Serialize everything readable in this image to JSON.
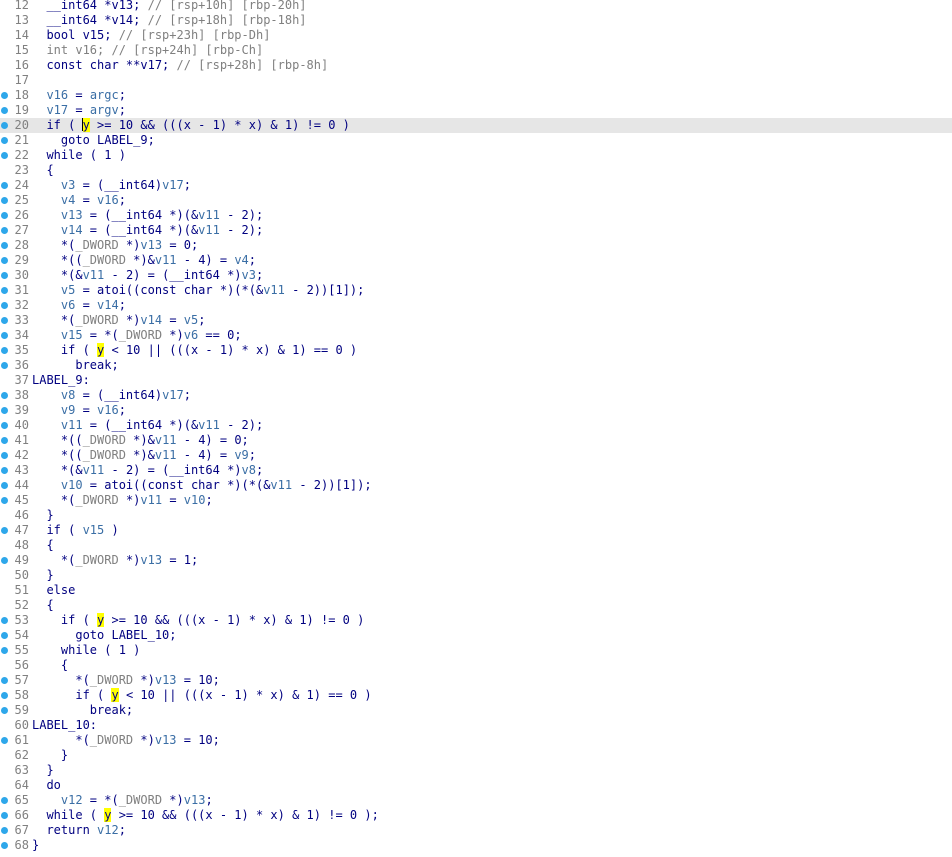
{
  "editor": {
    "current_line": 20,
    "caret": {
      "line": 20,
      "token": 1
    },
    "lines": [
      {
        "n": "12",
        "bp": false,
        "t": [
          [
            "k",
            "  __int64 *v13; "
          ],
          [
            "c",
            "// [rsp+10h] [rbp-20h]"
          ]
        ]
      },
      {
        "n": "13",
        "bp": false,
        "t": [
          [
            "k",
            "  __int64 *v14; "
          ],
          [
            "c",
            "// [rsp+18h] [rbp-18h]"
          ]
        ]
      },
      {
        "n": "14",
        "bp": false,
        "t": [
          [
            "k",
            "  bool v15; "
          ],
          [
            "c",
            "// [rsp+23h] [rbp-Dh]"
          ]
        ]
      },
      {
        "n": "15",
        "bp": false,
        "t": [
          [
            "g",
            "  int v16; "
          ],
          [
            "c",
            "// [rsp+24h] [rbp-Ch]"
          ]
        ]
      },
      {
        "n": "16",
        "bp": false,
        "t": [
          [
            "k",
            "  const char **v17; "
          ],
          [
            "c",
            "// [rsp+28h] [rbp-8h]"
          ]
        ]
      },
      {
        "n": "17",
        "bp": false,
        "t": []
      },
      {
        "n": "18",
        "bp": true,
        "t": [
          [
            "v",
            "  v16"
          ],
          [
            "k",
            " = "
          ],
          [
            "v",
            "argc"
          ],
          [
            "k",
            ";"
          ]
        ]
      },
      {
        "n": "19",
        "bp": true,
        "t": [
          [
            "v",
            "  v17"
          ],
          [
            "k",
            " = "
          ],
          [
            "v",
            "argv"
          ],
          [
            "k",
            ";"
          ]
        ]
      },
      {
        "n": "20",
        "bp": true,
        "t": [
          [
            "k",
            "  if ( "
          ],
          [
            "h",
            "y"
          ],
          [
            "k",
            " >= 10 && (((x - 1) * x) & 1) != 0 )"
          ]
        ]
      },
      {
        "n": "21",
        "bp": true,
        "t": [
          [
            "k",
            "    goto LABEL_9;"
          ]
        ]
      },
      {
        "n": "22",
        "bp": true,
        "t": [
          [
            "k",
            "  while ( 1 )"
          ]
        ]
      },
      {
        "n": "23",
        "bp": false,
        "t": [
          [
            "k",
            "  {"
          ]
        ]
      },
      {
        "n": "24",
        "bp": true,
        "t": [
          [
            "v",
            "    v3"
          ],
          [
            "k",
            " = (__int64)"
          ],
          [
            "v",
            "v17"
          ],
          [
            "k",
            ";"
          ]
        ]
      },
      {
        "n": "25",
        "bp": true,
        "t": [
          [
            "v",
            "    v4"
          ],
          [
            "k",
            " = "
          ],
          [
            "v",
            "v16"
          ],
          [
            "k",
            ";"
          ]
        ]
      },
      {
        "n": "26",
        "bp": true,
        "t": [
          [
            "v",
            "    v13"
          ],
          [
            "k",
            " = (__int64 *)(&"
          ],
          [
            "v",
            "v11"
          ],
          [
            "k",
            " - 2);"
          ]
        ]
      },
      {
        "n": "27",
        "bp": true,
        "t": [
          [
            "v",
            "    v14"
          ],
          [
            "k",
            " = (__int64 *)(&"
          ],
          [
            "v",
            "v11"
          ],
          [
            "k",
            " - 2);"
          ]
        ]
      },
      {
        "n": "28",
        "bp": true,
        "t": [
          [
            "k",
            "    *("
          ],
          [
            "g",
            "_DWORD"
          ],
          [
            "k",
            " *)"
          ],
          [
            "v",
            "v13"
          ],
          [
            "k",
            " = 0;"
          ]
        ]
      },
      {
        "n": "29",
        "bp": true,
        "t": [
          [
            "k",
            "    *(("
          ],
          [
            "g",
            "_DWORD"
          ],
          [
            "k",
            " *)&"
          ],
          [
            "v",
            "v11"
          ],
          [
            "k",
            " - 4) = "
          ],
          [
            "v",
            "v4"
          ],
          [
            "k",
            ";"
          ]
        ]
      },
      {
        "n": "30",
        "bp": true,
        "t": [
          [
            "k",
            "    *(&"
          ],
          [
            "v",
            "v11"
          ],
          [
            "k",
            " - 2) = (__int64 *)"
          ],
          [
            "v",
            "v3"
          ],
          [
            "k",
            ";"
          ]
        ]
      },
      {
        "n": "31",
        "bp": true,
        "t": [
          [
            "v",
            "    v5"
          ],
          [
            "k",
            " = atoi((const char *)(*(&"
          ],
          [
            "v",
            "v11"
          ],
          [
            "k",
            " - 2))[1]);"
          ]
        ]
      },
      {
        "n": "32",
        "bp": true,
        "t": [
          [
            "v",
            "    v6"
          ],
          [
            "k",
            " = "
          ],
          [
            "v",
            "v14"
          ],
          [
            "k",
            ";"
          ]
        ]
      },
      {
        "n": "33",
        "bp": true,
        "t": [
          [
            "k",
            "    *("
          ],
          [
            "g",
            "_DWORD"
          ],
          [
            "k",
            " *)"
          ],
          [
            "v",
            "v14"
          ],
          [
            "k",
            " = "
          ],
          [
            "v",
            "v5"
          ],
          [
            "k",
            ";"
          ]
        ]
      },
      {
        "n": "34",
        "bp": true,
        "t": [
          [
            "v",
            "    v15"
          ],
          [
            "k",
            " = *("
          ],
          [
            "g",
            "_DWORD"
          ],
          [
            "k",
            " *)"
          ],
          [
            "v",
            "v6"
          ],
          [
            "k",
            " == 0;"
          ]
        ]
      },
      {
        "n": "35",
        "bp": true,
        "t": [
          [
            "k",
            "    if ( "
          ],
          [
            "h",
            "y"
          ],
          [
            "k",
            " < 10 || (((x - 1) * x) & 1) == 0 )"
          ]
        ]
      },
      {
        "n": "36",
        "bp": true,
        "t": [
          [
            "k",
            "      break;"
          ]
        ]
      },
      {
        "n": "37",
        "bp": false,
        "t": [
          [
            "k",
            "LABEL_9:"
          ]
        ],
        "label": true
      },
      {
        "n": "38",
        "bp": true,
        "t": [
          [
            "v",
            "    v8"
          ],
          [
            "k",
            " = (__int64)"
          ],
          [
            "v",
            "v17"
          ],
          [
            "k",
            ";"
          ]
        ]
      },
      {
        "n": "39",
        "bp": true,
        "t": [
          [
            "v",
            "    v9"
          ],
          [
            "k",
            " = "
          ],
          [
            "v",
            "v16"
          ],
          [
            "k",
            ";"
          ]
        ]
      },
      {
        "n": "40",
        "bp": true,
        "t": [
          [
            "v",
            "    v11"
          ],
          [
            "k",
            " = (__int64 *)(&"
          ],
          [
            "v",
            "v11"
          ],
          [
            "k",
            " - 2);"
          ]
        ]
      },
      {
        "n": "41",
        "bp": true,
        "t": [
          [
            "k",
            "    *(("
          ],
          [
            "g",
            "_DWORD"
          ],
          [
            "k",
            " *)&"
          ],
          [
            "v",
            "v11"
          ],
          [
            "k",
            " - 4) = 0;"
          ]
        ]
      },
      {
        "n": "42",
        "bp": true,
        "t": [
          [
            "k",
            "    *(("
          ],
          [
            "g",
            "_DWORD"
          ],
          [
            "k",
            " *)&"
          ],
          [
            "v",
            "v11"
          ],
          [
            "k",
            " - 4) = "
          ],
          [
            "v",
            "v9"
          ],
          [
            "k",
            ";"
          ]
        ]
      },
      {
        "n": "43",
        "bp": true,
        "t": [
          [
            "k",
            "    *(&"
          ],
          [
            "v",
            "v11"
          ],
          [
            "k",
            " - 2) = (__int64 *)"
          ],
          [
            "v",
            "v8"
          ],
          [
            "k",
            ";"
          ]
        ]
      },
      {
        "n": "44",
        "bp": true,
        "t": [
          [
            "v",
            "    v10"
          ],
          [
            "k",
            " = atoi((const char *)(*(&"
          ],
          [
            "v",
            "v11"
          ],
          [
            "k",
            " - 2))[1]);"
          ]
        ]
      },
      {
        "n": "45",
        "bp": true,
        "t": [
          [
            "k",
            "    *("
          ],
          [
            "g",
            "_DWORD"
          ],
          [
            "k",
            " *)"
          ],
          [
            "v",
            "v11"
          ],
          [
            "k",
            " = "
          ],
          [
            "v",
            "v10"
          ],
          [
            "k",
            ";"
          ]
        ]
      },
      {
        "n": "46",
        "bp": false,
        "t": [
          [
            "k",
            "  }"
          ]
        ]
      },
      {
        "n": "47",
        "bp": true,
        "t": [
          [
            "k",
            "  if ( "
          ],
          [
            "v",
            "v15"
          ],
          [
            "k",
            " )"
          ]
        ]
      },
      {
        "n": "48",
        "bp": false,
        "t": [
          [
            "k",
            "  {"
          ]
        ]
      },
      {
        "n": "49",
        "bp": true,
        "t": [
          [
            "k",
            "    *("
          ],
          [
            "g",
            "_DWORD"
          ],
          [
            "k",
            " *)"
          ],
          [
            "v",
            "v13"
          ],
          [
            "k",
            " = 1;"
          ]
        ]
      },
      {
        "n": "50",
        "bp": false,
        "t": [
          [
            "k",
            "  }"
          ]
        ]
      },
      {
        "n": "51",
        "bp": false,
        "t": [
          [
            "k",
            "  else"
          ]
        ]
      },
      {
        "n": "52",
        "bp": false,
        "t": [
          [
            "k",
            "  {"
          ]
        ]
      },
      {
        "n": "53",
        "bp": true,
        "t": [
          [
            "k",
            "    if ( "
          ],
          [
            "h",
            "y"
          ],
          [
            "k",
            " >= 10 && (((x - 1) * x) & 1) != 0 )"
          ]
        ]
      },
      {
        "n": "54",
        "bp": true,
        "t": [
          [
            "k",
            "      goto LABEL_10;"
          ]
        ]
      },
      {
        "n": "55",
        "bp": true,
        "t": [
          [
            "k",
            "    while ( 1 )"
          ]
        ]
      },
      {
        "n": "56",
        "bp": false,
        "t": [
          [
            "k",
            "    {"
          ]
        ]
      },
      {
        "n": "57",
        "bp": true,
        "t": [
          [
            "k",
            "      *("
          ],
          [
            "g",
            "_DWORD"
          ],
          [
            "k",
            " *)"
          ],
          [
            "v",
            "v13"
          ],
          [
            "k",
            " = 10;"
          ]
        ]
      },
      {
        "n": "58",
        "bp": true,
        "t": [
          [
            "k",
            "      if ( "
          ],
          [
            "h",
            "y"
          ],
          [
            "k",
            " < 10 || (((x - 1) * x) & 1) == 0 )"
          ]
        ]
      },
      {
        "n": "59",
        "bp": true,
        "t": [
          [
            "k",
            "        break;"
          ]
        ]
      },
      {
        "n": "60",
        "bp": false,
        "t": [
          [
            "k",
            "LABEL_10:"
          ]
        ],
        "label": true
      },
      {
        "n": "61",
        "bp": true,
        "t": [
          [
            "k",
            "      *("
          ],
          [
            "g",
            "_DWORD"
          ],
          [
            "k",
            " *)"
          ],
          [
            "v",
            "v13"
          ],
          [
            "k",
            " = 10;"
          ]
        ]
      },
      {
        "n": "62",
        "bp": false,
        "t": [
          [
            "k",
            "    }"
          ]
        ]
      },
      {
        "n": "63",
        "bp": false,
        "t": [
          [
            "k",
            "  }"
          ]
        ]
      },
      {
        "n": "64",
        "bp": false,
        "t": [
          [
            "k",
            "  do"
          ]
        ]
      },
      {
        "n": "65",
        "bp": true,
        "t": [
          [
            "v",
            "    v12"
          ],
          [
            "k",
            " = *("
          ],
          [
            "g",
            "_DWORD"
          ],
          [
            "k",
            " *)"
          ],
          [
            "v",
            "v13"
          ],
          [
            "k",
            ";"
          ]
        ]
      },
      {
        "n": "66",
        "bp": true,
        "t": [
          [
            "k",
            "  while ( "
          ],
          [
            "h",
            "y"
          ],
          [
            "k",
            " >= 10 && (((x - 1) * x) & 1) != 0 );"
          ]
        ]
      },
      {
        "n": "67",
        "bp": true,
        "t": [
          [
            "k",
            "  return "
          ],
          [
            "v",
            "v12"
          ],
          [
            "k",
            ";"
          ]
        ]
      },
      {
        "n": "68",
        "bp": true,
        "t": [
          [
            "k",
            "}"
          ]
        ],
        "label": true
      }
    ]
  },
  "colors": {
    "keyword_text": "#000080",
    "variable": "#3a6ea5",
    "comment": "#808080",
    "highlight": "#ffff00",
    "breakpoint_dot": "#2ea7ea",
    "current_line_bg": "#e6e6e6"
  }
}
